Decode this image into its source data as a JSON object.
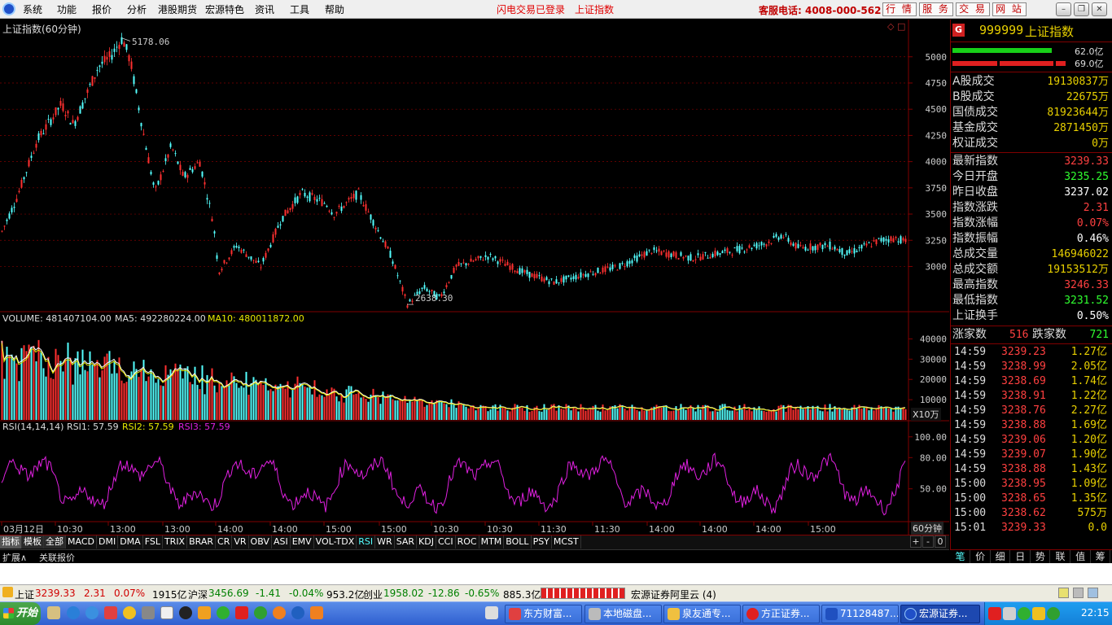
{
  "menubar": {
    "items": [
      "系统",
      "功能",
      "报价",
      "分析",
      "港股期货",
      "宏源特色",
      "资讯",
      "工具",
      "帮助"
    ],
    "status_login": "闪电交易已登录",
    "status_index": "上证指数",
    "hotline": "客服电话: 4008-000-562",
    "nav_buttons": [
      "行 情",
      "服 务",
      "交 易",
      "网 站"
    ]
  },
  "chart": {
    "title": "上证指数(60分钟)",
    "high_marker": "5178.06",
    "low_marker": "2638.30",
    "price_axis": [
      "5000",
      "4750",
      "4500",
      "4250",
      "4000",
      "3750",
      "3500",
      "3250",
      "3000"
    ],
    "volume_header": {
      "vol": "VOLUME: 481407104.00",
      "ma5": "MA5: 492280224.00",
      "ma10": "MA10: 480011872.00"
    },
    "volume_axis": [
      "40000",
      "30000",
      "20000",
      "10000"
    ],
    "volume_unit": "X10万",
    "rsi_header": {
      "name": "RSI(14,14,14)",
      "rsi1": "RSI1: 57.59",
      "rsi2": "RSI2: 57.59",
      "rsi3": "RSI3: 57.59"
    },
    "rsi_axis": [
      "100.00",
      "80.00",
      "50.00"
    ],
    "time_axis": [
      "03月12日",
      "10:30",
      "13:00",
      "13:00",
      "14:00",
      "14:00",
      "15:00",
      "15:00",
      "10:30",
      "10:30",
      "11:30",
      "11:30",
      "14:00",
      "14:00",
      "14:00",
      "15:00"
    ],
    "period": "60分钟",
    "colors": {
      "up": "#ff3030",
      "down": "#54ffff",
      "ma5": "#ffffff",
      "ma10": "#e8e800",
      "rsi": "#e020e0",
      "grid": "#800000"
    }
  },
  "indicator_tabs": [
    "指标",
    "模板",
    "全部",
    "MACD",
    "DMI",
    "DMA",
    "FSL",
    "TRIX",
    "BRAR",
    "CR",
    "VR",
    "OBV",
    "ASI",
    "EMV",
    "VOL-TDX",
    "RSI",
    "WR",
    "SAR",
    "KDJ",
    "CCI",
    "ROC",
    "MTM",
    "BOLL",
    "PSY",
    "MCST"
  ],
  "active_indicator": "RSI",
  "extra_tabs": [
    "扩展∧",
    "关联报价"
  ],
  "zoom_controls": [
    "+",
    "-",
    "0"
  ],
  "quote": {
    "badge": "G",
    "code": "999999",
    "name": "上证指数",
    "bar_up": "62.0亿",
    "bar_down": "69.0亿",
    "turnover": [
      {
        "label": "A股成交",
        "value": "19130837万"
      },
      {
        "label": "B股成交",
        "value": "22675万"
      },
      {
        "label": "国债成交",
        "value": "81923644万"
      },
      {
        "label": "基金成交",
        "value": "2871450万"
      },
      {
        "label": "权证成交",
        "value": "0万"
      }
    ],
    "stats": [
      {
        "label": "最新指数",
        "value": "3239.33",
        "color": "#ff4040"
      },
      {
        "label": "今日开盘",
        "value": "3235.25",
        "color": "#30ff30"
      },
      {
        "label": "昨日收盘",
        "value": "3237.02",
        "color": "#ffffff"
      },
      {
        "label": "指数涨跌",
        "value": "2.31",
        "color": "#ff4040"
      },
      {
        "label": "指数涨幅",
        "value": "0.07%",
        "color": "#ff4040"
      },
      {
        "label": "指数振幅",
        "value": "0.46%",
        "color": "#ffffff"
      },
      {
        "label": "总成交量",
        "value": "146946022",
        "color": "#e8d000"
      },
      {
        "label": "总成交额",
        "value": "19153512万",
        "color": "#e8d000"
      },
      {
        "label": "最高指数",
        "value": "3246.33",
        "color": "#ff4040"
      },
      {
        "label": "最低指数",
        "value": "3231.52",
        "color": "#30ff30"
      },
      {
        "label": "上证换手",
        "value": "0.50%",
        "color": "#ffffff"
      }
    ],
    "advance_label": "涨家数",
    "advance": "516",
    "decline_label": "跌家数",
    "decline": "721",
    "ticks": [
      {
        "time": "14:59",
        "price": "3239.23",
        "vol": "1.27亿"
      },
      {
        "time": "14:59",
        "price": "3238.99",
        "vol": "2.05亿"
      },
      {
        "time": "14:59",
        "price": "3238.69",
        "vol": "1.74亿"
      },
      {
        "time": "14:59",
        "price": "3238.91",
        "vol": "1.22亿"
      },
      {
        "time": "14:59",
        "price": "3238.76",
        "vol": "2.27亿"
      },
      {
        "time": "14:59",
        "price": "3238.88",
        "vol": "1.69亿"
      },
      {
        "time": "14:59",
        "price": "3239.06",
        "vol": "1.20亿"
      },
      {
        "time": "14:59",
        "price": "3239.07",
        "vol": "1.90亿"
      },
      {
        "time": "14:59",
        "price": "3238.88",
        "vol": "1.43亿"
      },
      {
        "time": "15:00",
        "price": "3238.95",
        "vol": "1.09亿"
      },
      {
        "time": "15:00",
        "price": "3238.65",
        "vol": "1.35亿"
      },
      {
        "time": "15:00",
        "price": "3238.62",
        "vol": "575万"
      },
      {
        "time": "15:01",
        "price": "3239.33",
        "vol": "0.0"
      }
    ],
    "tabs": [
      "笔",
      "价",
      "细",
      "日",
      "势",
      "联",
      "值",
      "筹"
    ]
  },
  "indexbar": {
    "sh": {
      "name": "上证",
      "value": "3239.33",
      "change": "2.31",
      "pct": "0.07%",
      "amount": "1915亿"
    },
    "hs": {
      "name": "沪深",
      "value": "3456.69",
      "change": "-1.41",
      "pct": "-0.04%",
      "amount": "953.2亿"
    },
    "cy": {
      "name": "创业",
      "value": "1958.02",
      "change": "-12.86",
      "pct": "-0.65%",
      "amount": "885.3亿"
    },
    "broker": "宏源证券阿里云 (4)"
  },
  "taskbar": {
    "start": "开始",
    "tasks": [
      "东方财富...",
      "本地磁盘...",
      "泉友通专...",
      "方正证券...",
      "71128487...",
      "宏源证券..."
    ],
    "clock": "22:15"
  }
}
